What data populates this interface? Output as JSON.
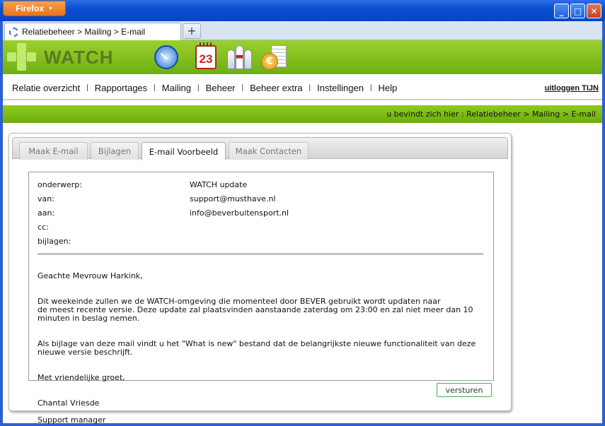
{
  "window": {
    "app_button": "Firefox",
    "minimize": "_",
    "maximize": "□",
    "close": "✕"
  },
  "browser": {
    "tab_title": "Relatiebeheer > Mailing > E-mail",
    "new_tab": "+"
  },
  "app": {
    "brand": "WATCH",
    "calendar_day": "23",
    "menu": [
      "Relatie overzicht",
      "Rapportages",
      "Mailing",
      "Beheer",
      "Beheer extra",
      "Instellingen",
      "Help"
    ],
    "menu_sep": "|",
    "logout": "uitloggen TIJN",
    "breadcrumb": "u bevindt zich hier : Relatiebeheer > Mailing > E-mail"
  },
  "tabs": [
    "Maak E-mail",
    "Bijlagen",
    "E-mail Voorbeeld",
    "Maak Contacten"
  ],
  "active_tab": "E-mail Voorbeeld",
  "email": {
    "subject_label": "onderwerp:",
    "subject": "WATCH update",
    "from_label": "van:",
    "from": "support@musthave.nl",
    "to_label": "aan:",
    "to": "info@beverbuitensport.nl",
    "cc_label": "cc:",
    "cc": "",
    "attachments_label": "bijlagen:",
    "attachments": "",
    "greeting": "Geachte Mevrouw Harkink,",
    "paragraph1": "Dit weekeinde zullen we de WATCH-omgeving die momenteel door BEVER gebruikt wordt updaten naar\nde meest recente versie. Deze update zal plaatsvinden aanstaande zaterdag om 23:00 en zal niet meer dan 10\nminuten in beslag nemen.",
    "paragraph2": "Als bijlage van deze mail vindt u het \"What is new\" bestand dat de belangrijkste nieuwe functionaliteit van deze\nnieuwe versie beschrijft.",
    "closing": "Met vriendelijke groet,",
    "signature_name": "Chantal Vriesde",
    "signature_title": "Support manager"
  },
  "send_button": "versturen",
  "colors": {
    "header_green": "#8cc63f",
    "titlebar_blue": "#0a4fd1",
    "firefox_orange": "#e8731c"
  }
}
